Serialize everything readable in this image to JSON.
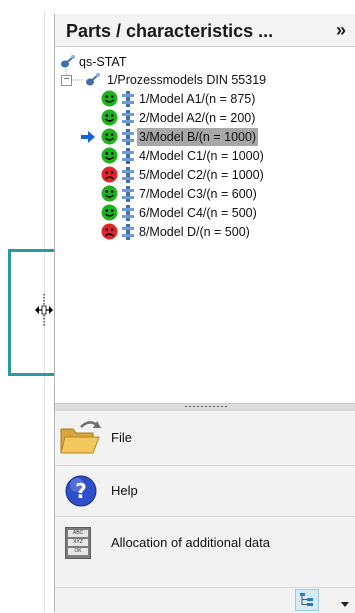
{
  "header": {
    "title": "Parts / characteristics ...",
    "chevron": "»"
  },
  "tree": {
    "root": {
      "label": "qs-STAT"
    },
    "group": {
      "label": "1/Prozessmodels DIN 55319",
      "expander": "−"
    },
    "items": [
      {
        "label": "1/Model A1/(n = 875)",
        "status": "good"
      },
      {
        "label": "2/Model A2/(n = 200)",
        "status": "good"
      },
      {
        "label": "3/Model B/(n = 1000)",
        "status": "good",
        "selected": true
      },
      {
        "label": "4/Model C1/(n = 1000)",
        "status": "good"
      },
      {
        "label": "5/Model C2/(n = 1000)",
        "status": "bad"
      },
      {
        "label": "7/Model C3/(n = 600)",
        "status": "good"
      },
      {
        "label": "6/Model C4/(n = 500)",
        "status": "good"
      },
      {
        "label": "8/Model D/(n = 500)",
        "status": "bad"
      }
    ]
  },
  "nav": {
    "file_label": "File",
    "help_label": "Help",
    "allocation_label": "Allocation of additional data",
    "allocation_icon_text": [
      "ABC",
      "XYZ",
      "OK"
    ]
  },
  "colors": {
    "good_face": "#1fb21f",
    "bad_face": "#e0262a",
    "accent": "#2a9aa0",
    "arrow": "#1565d8",
    "selection": "#a7a7a7"
  }
}
